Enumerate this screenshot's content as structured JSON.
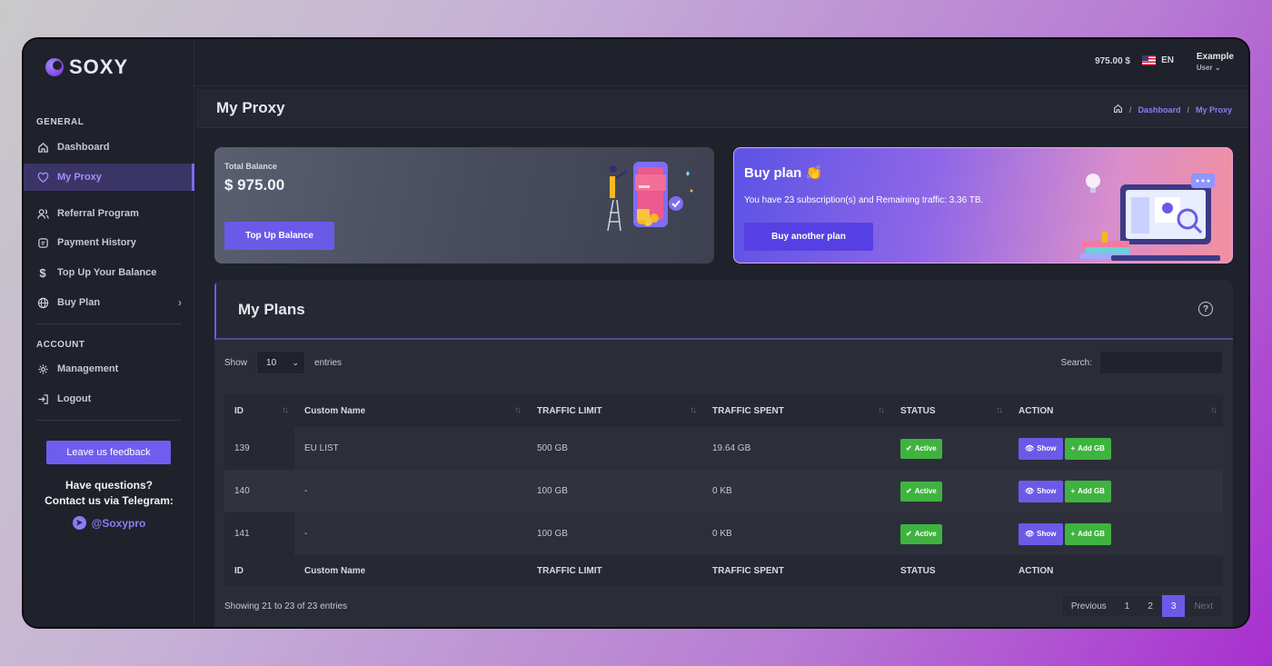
{
  "brand": {
    "name": "SOXY"
  },
  "sidebar": {
    "general_label": "GENERAL",
    "account_label": "ACCOUNT",
    "items": [
      {
        "label": "Dashboard",
        "icon": "home-icon"
      },
      {
        "label": "My Proxy",
        "icon": "heart-icon",
        "active": true
      },
      {
        "label": "Referral Program",
        "icon": "users-icon"
      },
      {
        "label": "Payment History",
        "icon": "receipt-icon"
      },
      {
        "label": "Top Up Your Balance",
        "icon": "dollar-icon"
      },
      {
        "label": "Buy Plan",
        "icon": "globe-icon"
      }
    ],
    "account_items": [
      {
        "label": "Management",
        "icon": "gear-icon"
      },
      {
        "label": "Logout",
        "icon": "logout-icon"
      }
    ],
    "feedback_label": "Leave us feedback",
    "questions_line1": "Have questions?",
    "questions_line2": "Contact us via Telegram:",
    "telegram_handle": "@Soxypro"
  },
  "topbar": {
    "balance": "975.00 $",
    "language": "EN",
    "user_name": "Example",
    "user_role": "User"
  },
  "page": {
    "title": "My Proxy",
    "breadcrumbs": [
      "Dashboard",
      "My Proxy"
    ]
  },
  "balance_card": {
    "label": "Total Balance",
    "amount": "$ 975.00",
    "button": "Top Up Balance"
  },
  "plan_card": {
    "title": "Buy plan 👏",
    "description": "You have 23 subscription(s) and Remaining traffic: 3.36 TB.",
    "button": "Buy another plan"
  },
  "plans": {
    "title": "My Plans",
    "show_label": "Show",
    "entries_value": "10",
    "entries_label": "entries",
    "search_label": "Search:",
    "columns": [
      "ID",
      "Custom Name",
      "TRAFFIC LIMIT",
      "TRAFFIC SPENT",
      "STATUS",
      "ACTION"
    ],
    "rows": [
      {
        "id": "139",
        "name": "EU LIST",
        "limit": "500 GB",
        "spent": "19.64 GB",
        "status": "Active"
      },
      {
        "id": "140",
        "name": "-",
        "limit": "100 GB",
        "spent": "0 KB",
        "status": "Active"
      },
      {
        "id": "141",
        "name": "-",
        "limit": "100 GB",
        "spent": "0 KB",
        "status": "Active"
      }
    ],
    "show_button": "Show",
    "add_button": "Add GB",
    "info": "Showing 21 to 23 of 23 entries",
    "pager": {
      "previous": "Previous",
      "pages": [
        "1",
        "2",
        "3"
      ],
      "current": "3",
      "next": "Next"
    }
  },
  "colors": {
    "accent": "#6b5ae8",
    "success": "#3fb33f",
    "background": "#1f222b"
  }
}
